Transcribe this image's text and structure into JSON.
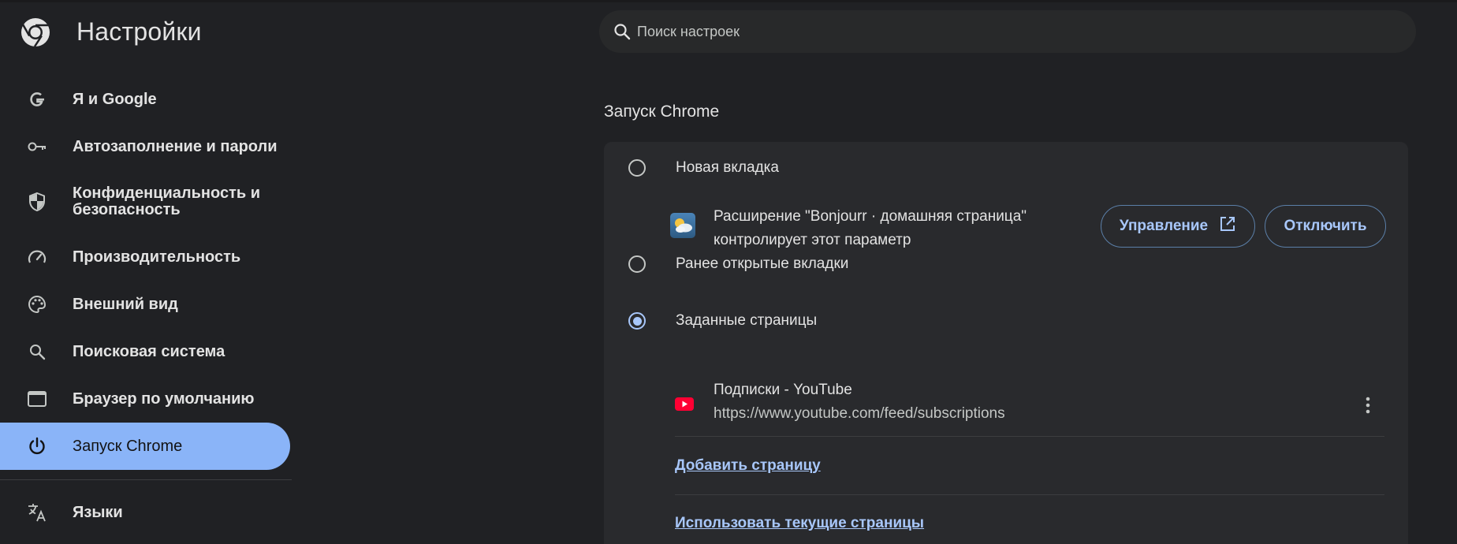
{
  "header": {
    "title": "Настройки",
    "logo": "chrome-logo"
  },
  "search": {
    "placeholder": "Поиск настроек",
    "value": ""
  },
  "sidebar": {
    "items": [
      {
        "label": "Я и Google",
        "icon": "google-g-icon",
        "active": false
      },
      {
        "label": "Автозаполнение и пароли",
        "icon": "key-icon",
        "active": false
      },
      {
        "label": "Конфиденциальность и безопасность",
        "icon": "shield-icon",
        "active": false
      },
      {
        "label": "Производительность",
        "icon": "speedometer-icon",
        "active": false
      },
      {
        "label": "Внешний вид",
        "icon": "palette-icon",
        "active": false
      },
      {
        "label": "Поисковая система",
        "icon": "search-icon",
        "active": false
      },
      {
        "label": "Браузер по умолчанию",
        "icon": "browser-window-icon",
        "active": false
      },
      {
        "label": "Запуск Chrome",
        "icon": "power-icon",
        "active": true
      },
      {
        "label": "Языки",
        "icon": "translate-icon",
        "active": false
      }
    ]
  },
  "main": {
    "section_title": "Запуск Chrome",
    "options": [
      {
        "label": "Новая вкладка",
        "checked": false
      },
      {
        "label": "Ранее открытые вкладки",
        "checked": false
      },
      {
        "label": "Заданные страницы",
        "checked": true
      }
    ],
    "extension_notice": {
      "line1": "Расширение \"Bonjourr · домашняя страница\"",
      "line2": "контролирует этот параметр",
      "manage_label": "Управление",
      "disable_label": "Отключить"
    },
    "pages": [
      {
        "title": "Подписки - YouTube",
        "url": "https://www.youtube.com/feed/subscriptions"
      }
    ],
    "add_page_label": "Добавить страницу",
    "use_current_label": "Использовать текущие страницы"
  },
  "colors": {
    "background": "#202124",
    "card": "#292a2d",
    "accent": "#8ab4f8",
    "link": "#a8c7fa"
  }
}
